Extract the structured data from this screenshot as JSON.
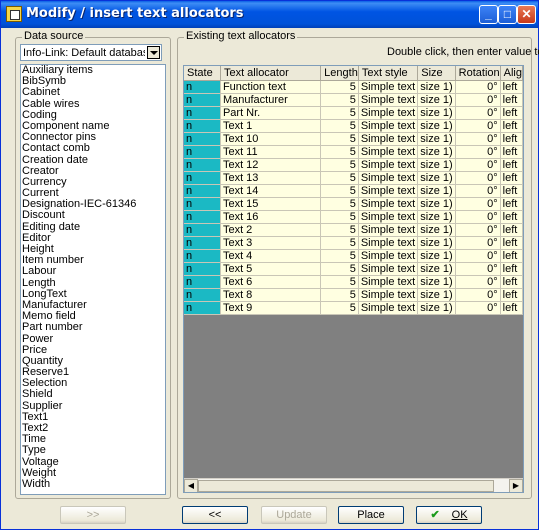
{
  "window": {
    "title": "Modify / insert text allocators",
    "min": "_",
    "max": "□",
    "close": "✕"
  },
  "data_source": {
    "group_label": "Data source",
    "select_value": "Info-Link: Default database fields",
    "items": [
      "Auxiliary items",
      "BibSymb",
      "Cabinet",
      "Cable wires",
      "Coding",
      "Component name",
      "Connector pins",
      "Contact comb",
      "Creation date",
      "Creator",
      "Currency",
      "Current",
      "Designation-IEC-61346",
      "Discount",
      "Editing date",
      "Editor",
      "Height",
      "Item number",
      "Labour",
      "Length",
      "LongText",
      "Manufacturer",
      "Memo field",
      "Part number",
      "Power",
      "Price",
      "Quantity",
      "Reserve1",
      "Selection",
      "Shield",
      "Supplier",
      "Text1",
      "Text2",
      "Time",
      "Type",
      "Voltage",
      "Weight",
      "Width"
    ]
  },
  "existing": {
    "group_label": "Existing text allocators",
    "hint": "Double click, then enter value to edit",
    "columns": [
      "State",
      "Text allocator",
      "Length",
      "Text style",
      "Size",
      "Rotation",
      "Alig"
    ],
    "rows": [
      [
        "n",
        "Function text",
        "5",
        "Simple text",
        "size 1)",
        "0°",
        "left"
      ],
      [
        "n",
        "Manufacturer",
        "5",
        "Simple text",
        "size 1)",
        "0°",
        "left"
      ],
      [
        "n",
        "Part Nr.",
        "5",
        "Simple text",
        "size 1)",
        "0°",
        "left"
      ],
      [
        "n",
        "Text 1",
        "5",
        "Simple text",
        "size 1)",
        "0°",
        "left"
      ],
      [
        "n",
        "Text 10",
        "5",
        "Simple text",
        "size 1)",
        "0°",
        "left"
      ],
      [
        "n",
        "Text 11",
        "5",
        "Simple text",
        "size 1)",
        "0°",
        "left"
      ],
      [
        "n",
        "Text 12",
        "5",
        "Simple text",
        "size 1)",
        "0°",
        "left"
      ],
      [
        "n",
        "Text 13",
        "5",
        "Simple text",
        "size 1)",
        "0°",
        "left"
      ],
      [
        "n",
        "Text 14",
        "5",
        "Simple text",
        "size 1)",
        "0°",
        "left"
      ],
      [
        "n",
        "Text 15",
        "5",
        "Simple text",
        "size 1)",
        "0°",
        "left"
      ],
      [
        "n",
        "Text 16",
        "5",
        "Simple text",
        "size 1)",
        "0°",
        "left"
      ],
      [
        "n",
        "Text 2",
        "5",
        "Simple text",
        "size 1)",
        "0°",
        "left"
      ],
      [
        "n",
        "Text 3",
        "5",
        "Simple text",
        "size 1)",
        "0°",
        "left"
      ],
      [
        "n",
        "Text 4",
        "5",
        "Simple text",
        "size 1)",
        "0°",
        "left"
      ],
      [
        "n",
        "Text 5",
        "5",
        "Simple text",
        "size 1)",
        "0°",
        "left"
      ],
      [
        "n",
        "Text 6",
        "5",
        "Simple text",
        "size 1)",
        "0°",
        "left"
      ],
      [
        "n",
        "Text 8",
        "5",
        "Simple text",
        "size 1)",
        "0°",
        "left"
      ],
      [
        "n",
        "Text 9",
        "5",
        "Simple text",
        "size 1)",
        "0°",
        "left"
      ]
    ]
  },
  "buttons": {
    "next": ">>",
    "prev": "<<",
    "update": "Update",
    "place": "Place",
    "ok": "OK",
    "ok_icon": "✔"
  },
  "colors": {
    "state_cell": "#1bb9c4",
    "row_bg": "#ffffe1",
    "titlebar": "#0054e3"
  }
}
